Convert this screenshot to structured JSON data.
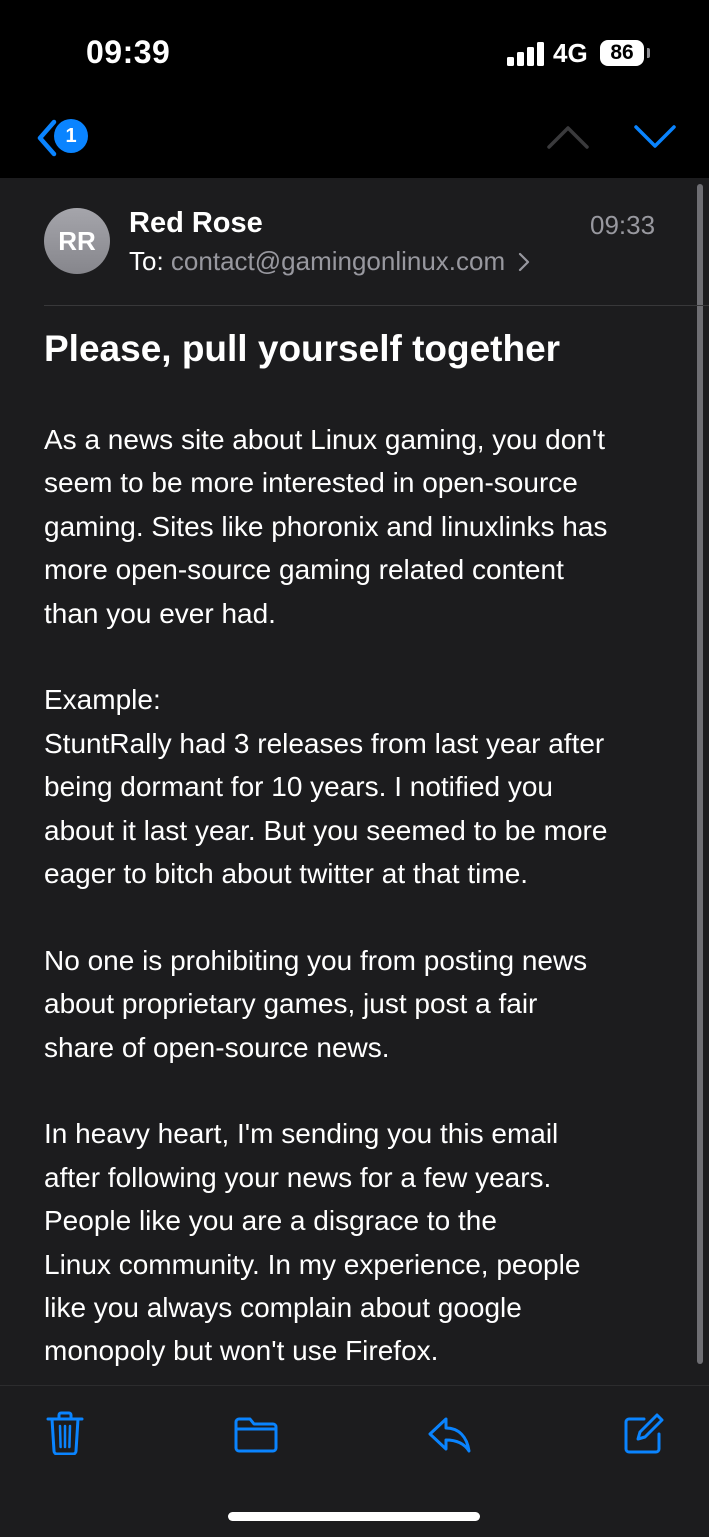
{
  "status": {
    "time": "09:39",
    "network": "4G",
    "battery": "86"
  },
  "nav": {
    "back_badge": "1"
  },
  "email": {
    "avatar_initials": "RR",
    "sender": "Red Rose",
    "to_label": "To:",
    "to_address": "contact@gamingonlinux.com",
    "time": "09:33",
    "subject": "Please, pull yourself together",
    "paragraphs": [
      [
        "As a news site about Linux gaming, you don't",
        "seem to be more interested in open-source",
        "gaming. Sites like phoronix and linuxlinks has",
        "more open-source gaming related content",
        "than you ever had."
      ],
      [
        "Example:",
        "StuntRally had 3 releases from last year after",
        "being dormant for 10 years. I notified you",
        "about it last year. But you seemed to be more",
        "eager to bitch about twitter at that time."
      ],
      [
        "No one is prohibiting you from posting news",
        "about proprietary games, just post a fair",
        "share of open-source news."
      ],
      [
        "In heavy heart, I'm sending you this email",
        "after following your news for a few years.",
        "People like you are a disgrace to the",
        "Linux community. In my experience, people",
        "like you always complain about google",
        "monopoly but won't use Firefox."
      ]
    ]
  },
  "toolbar": {
    "icons": [
      "trash-icon",
      "folder-icon",
      "reply-icon",
      "compose-icon"
    ]
  },
  "colors": {
    "accent": "#0a84ff",
    "background": "#1c1c1e",
    "secondary_text": "#98989f"
  }
}
